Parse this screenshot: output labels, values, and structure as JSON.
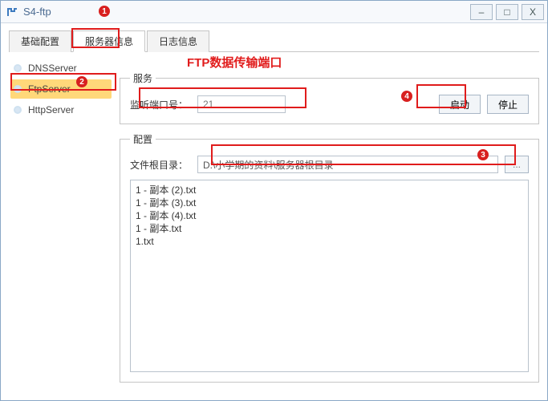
{
  "window": {
    "title": "S4-ftp"
  },
  "tabs": {
    "basic": "基础配置",
    "server": "服务器信息",
    "log": "日志信息"
  },
  "sidebar": {
    "dns": "DNSServer",
    "ftp": "FtpServer",
    "http": "HttpServer"
  },
  "heading": "FTP数据传输端口",
  "service": {
    "legend": "服务",
    "port_label": "监听端口号：",
    "port_value": "21",
    "start": "启动",
    "stop": "停止"
  },
  "config": {
    "legend": "配置",
    "root_label": "文件根目录：",
    "root_value": "D:\\小学期的资料\\服务器根目录",
    "browse": "..."
  },
  "files": [
    "1 - 副本 (2).txt",
    "1 - 副本 (3).txt",
    "1 - 副本 (4).txt",
    "1 - 副本.txt",
    "1.txt"
  ],
  "callouts": {
    "c1": "1",
    "c2": "2",
    "c3": "3",
    "c4": "4"
  }
}
